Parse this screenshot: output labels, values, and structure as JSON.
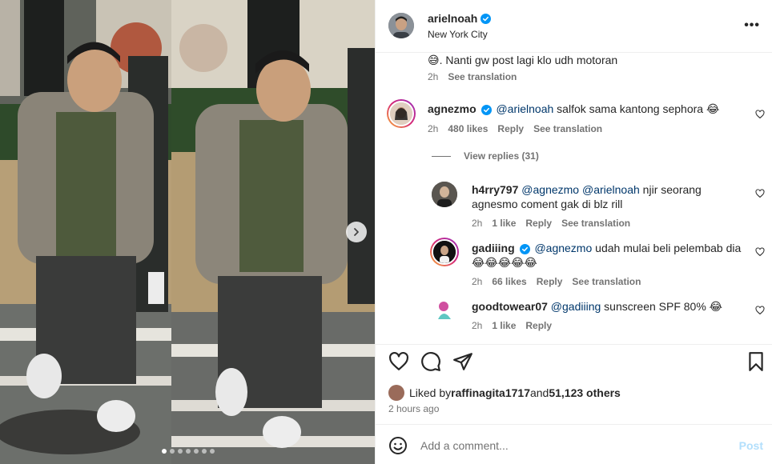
{
  "post": {
    "username": "arielnoah",
    "location": "New York City",
    "more_label": "•••",
    "caption_tail": ". Nanti gw post lagi klo udh motoran",
    "caption_emoji": "😅",
    "caption_time": "2h",
    "caption_see_translation": "See translation"
  },
  "comments": [
    {
      "username": "agnezmo",
      "verified": true,
      "mention": "@arielnoah",
      "text": " salfok sama kantong sephora 😂",
      "time": "2h",
      "likes": "480 likes",
      "reply_label": "Reply",
      "translation_label": "See translation",
      "view_replies": "View replies (31)"
    },
    {
      "username": "h4rry797",
      "verified": false,
      "mention": "@agnezmo @arielnoah",
      "text": " njir seorang agnesmo coment gak di blz rill",
      "time": "2h",
      "likes": "1 like",
      "reply_label": "Reply",
      "translation_label": "See translation"
    },
    {
      "username": "gadiiing",
      "verified": true,
      "mention": "@agnezmo",
      "text": " udah mulai beli pelembab dia 😂😂😂😂😂",
      "time": "2h",
      "likes": "66 likes",
      "reply_label": "Reply",
      "translation_label": "See translation"
    },
    {
      "username": "goodtowear07",
      "verified": false,
      "mention": "@gadiiing",
      "text": " sunscreen SPF 80% 😂",
      "time": "2h",
      "likes": "1 like",
      "reply_label": "Reply"
    }
  ],
  "likes": {
    "prefix": "Liked by ",
    "user": "raffinagita1717",
    "middle": " and ",
    "count": "51,123 others"
  },
  "time_ago": "2 hours ago",
  "add_comment": {
    "placeholder": "Add a comment...",
    "post_label": "Post"
  },
  "icons": {
    "like": "heart-icon",
    "comment": "comment-icon",
    "share": "share-icon",
    "save": "bookmark-icon",
    "emoji": "emoji-icon",
    "verified": "verified-badge-icon",
    "next": "chevron-right-icon"
  },
  "colors": {
    "verified": "#0095f6",
    "mention": "#00376b",
    "secondary_text": "#737373",
    "post_disabled": "#b2dffc"
  },
  "carousel": {
    "total_slides": 7,
    "current_slide": 1
  }
}
